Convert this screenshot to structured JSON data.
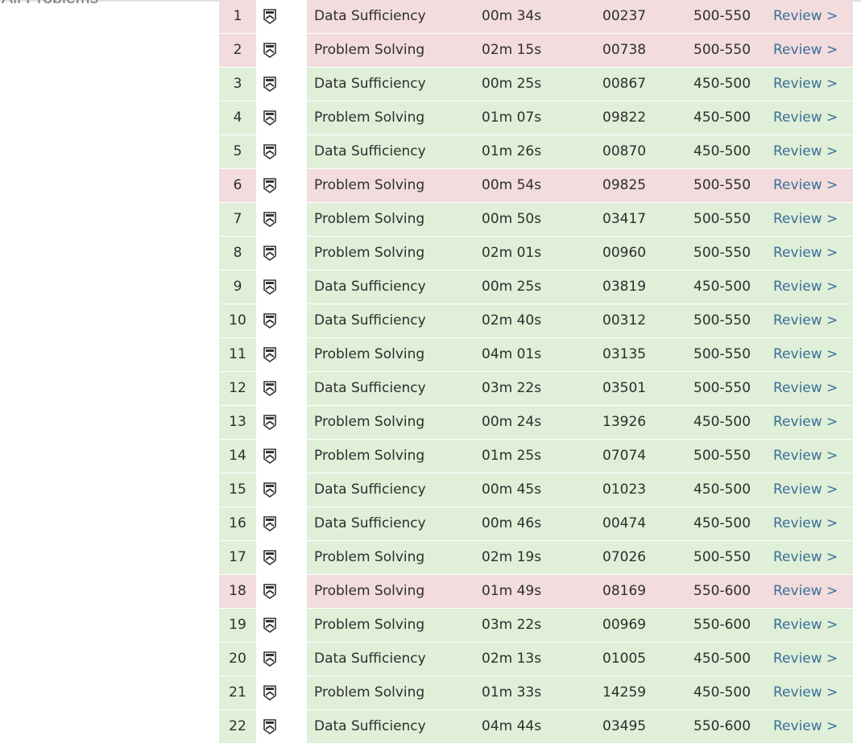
{
  "page": {
    "section_title": "All Problems"
  },
  "table": {
    "review_label": "Review >",
    "rows": [
      {
        "num": "1",
        "status": "incorrect",
        "type": "Data Sufficiency",
        "time": "00m 34s",
        "id": "00237",
        "difficulty": "500-550"
      },
      {
        "num": "2",
        "status": "incorrect",
        "type": "Problem Solving",
        "time": "02m 15s",
        "id": "00738",
        "difficulty": "500-550"
      },
      {
        "num": "3",
        "status": "correct",
        "type": "Data Sufficiency",
        "time": "00m 25s",
        "id": "00867",
        "difficulty": "450-500"
      },
      {
        "num": "4",
        "status": "correct",
        "type": "Problem Solving",
        "time": "01m 07s",
        "id": "09822",
        "difficulty": "450-500"
      },
      {
        "num": "5",
        "status": "correct",
        "type": "Data Sufficiency",
        "time": "01m 26s",
        "id": "00870",
        "difficulty": "450-500"
      },
      {
        "num": "6",
        "status": "incorrect",
        "type": "Problem Solving",
        "time": "00m 54s",
        "id": "09825",
        "difficulty": "500-550"
      },
      {
        "num": "7",
        "status": "correct",
        "type": "Problem Solving",
        "time": "00m 50s",
        "id": "03417",
        "difficulty": "500-550"
      },
      {
        "num": "8",
        "status": "correct",
        "type": "Problem Solving",
        "time": "02m 01s",
        "id": "00960",
        "difficulty": "500-550"
      },
      {
        "num": "9",
        "status": "correct",
        "type": "Data Sufficiency",
        "time": "00m 25s",
        "id": "03819",
        "difficulty": "450-500"
      },
      {
        "num": "10",
        "status": "correct",
        "type": "Data Sufficiency",
        "time": "02m 40s",
        "id": "00312",
        "difficulty": "500-550"
      },
      {
        "num": "11",
        "status": "correct",
        "type": "Problem Solving",
        "time": "04m 01s",
        "id": "03135",
        "difficulty": "500-550"
      },
      {
        "num": "12",
        "status": "correct",
        "type": "Data Sufficiency",
        "time": "03m 22s",
        "id": "03501",
        "difficulty": "500-550"
      },
      {
        "num": "13",
        "status": "correct",
        "type": "Problem Solving",
        "time": "00m 24s",
        "id": "13926",
        "difficulty": "450-500"
      },
      {
        "num": "14",
        "status": "correct",
        "type": "Problem Solving",
        "time": "01m 25s",
        "id": "07074",
        "difficulty": "500-550"
      },
      {
        "num": "15",
        "status": "correct",
        "type": "Data Sufficiency",
        "time": "00m 45s",
        "id": "01023",
        "difficulty": "450-500"
      },
      {
        "num": "16",
        "status": "correct",
        "type": "Data Sufficiency",
        "time": "00m 46s",
        "id": "00474",
        "difficulty": "450-500"
      },
      {
        "num": "17",
        "status": "correct",
        "type": "Problem Solving",
        "time": "02m 19s",
        "id": "07026",
        "difficulty": "500-550"
      },
      {
        "num": "18",
        "status": "incorrect",
        "type": "Problem Solving",
        "time": "01m 49s",
        "id": "08169",
        "difficulty": "550-600"
      },
      {
        "num": "19",
        "status": "correct",
        "type": "Problem Solving",
        "time": "03m 22s",
        "id": "00969",
        "difficulty": "550-600"
      },
      {
        "num": "20",
        "status": "correct",
        "type": "Data Sufficiency",
        "time": "02m 13s",
        "id": "01005",
        "difficulty": "450-500"
      },
      {
        "num": "21",
        "status": "correct",
        "type": "Problem Solving",
        "time": "01m 33s",
        "id": "14259",
        "difficulty": "450-500"
      },
      {
        "num": "22",
        "status": "correct",
        "type": "Data Sufficiency",
        "time": "04m 44s",
        "id": "03495",
        "difficulty": "550-600"
      }
    ]
  },
  "colors": {
    "incorrect_row": "#f2dcdd",
    "correct_row": "#dfefd8",
    "link": "#3a6e98"
  },
  "icons": {
    "row_icon": "shield-chevron-icon"
  }
}
